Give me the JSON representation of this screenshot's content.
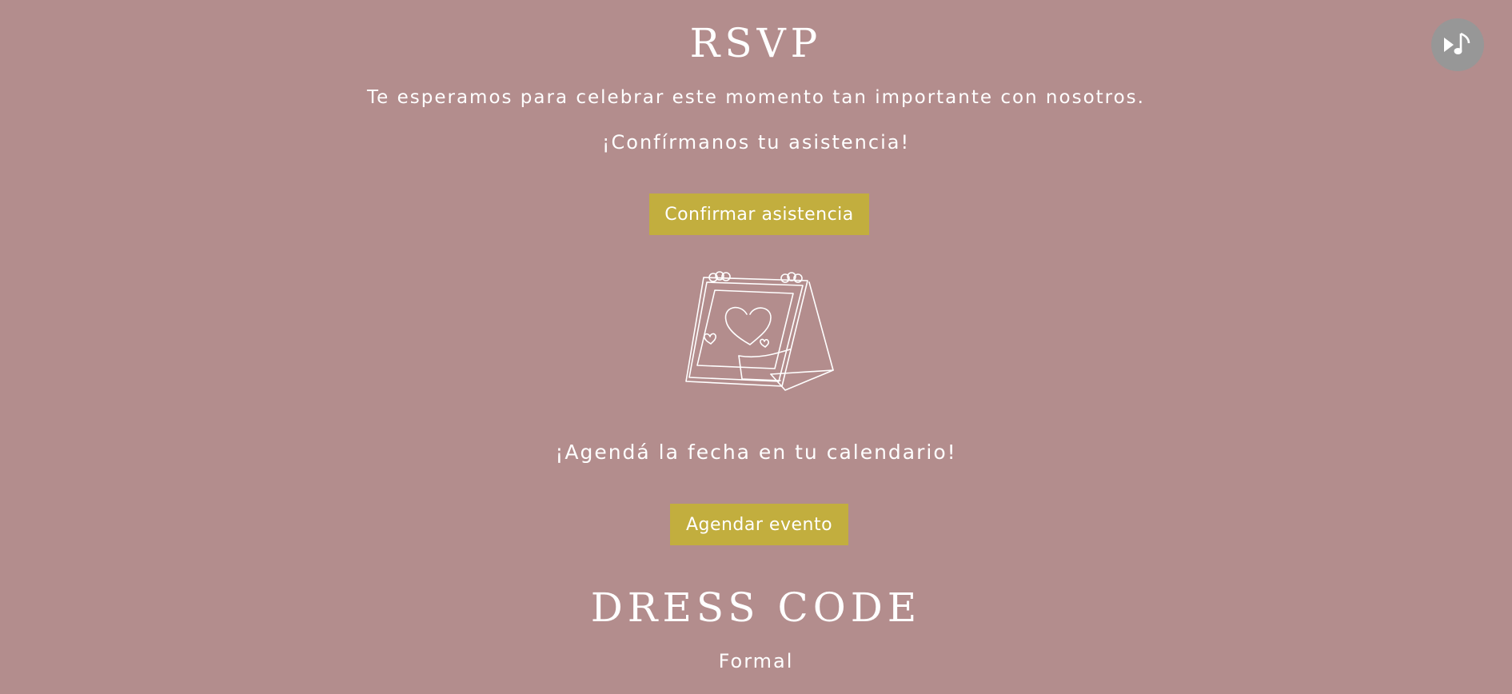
{
  "rsvp": {
    "title": "RSVP",
    "subtitle": "Te esperamos para celebrar este momento tan importante con nosotros.",
    "confirm_prompt": "¡Confírmanos tu asistencia!",
    "confirm_button_label": "Confirmar asistencia"
  },
  "calendar": {
    "illustration_icon": "desk-calendar-heart-icon",
    "prompt": "¡Agendá la fecha en tu calendario!",
    "add_button_label": "Agendar evento"
  },
  "dress_code": {
    "title": "DRESS CODE",
    "value": "Formal"
  },
  "music_player": {
    "icon": "play-music-icon"
  },
  "colors": {
    "background": "#b38d8d",
    "button": "#c2ae3e",
    "music_button": "#979797",
    "text": "#ffffff"
  }
}
